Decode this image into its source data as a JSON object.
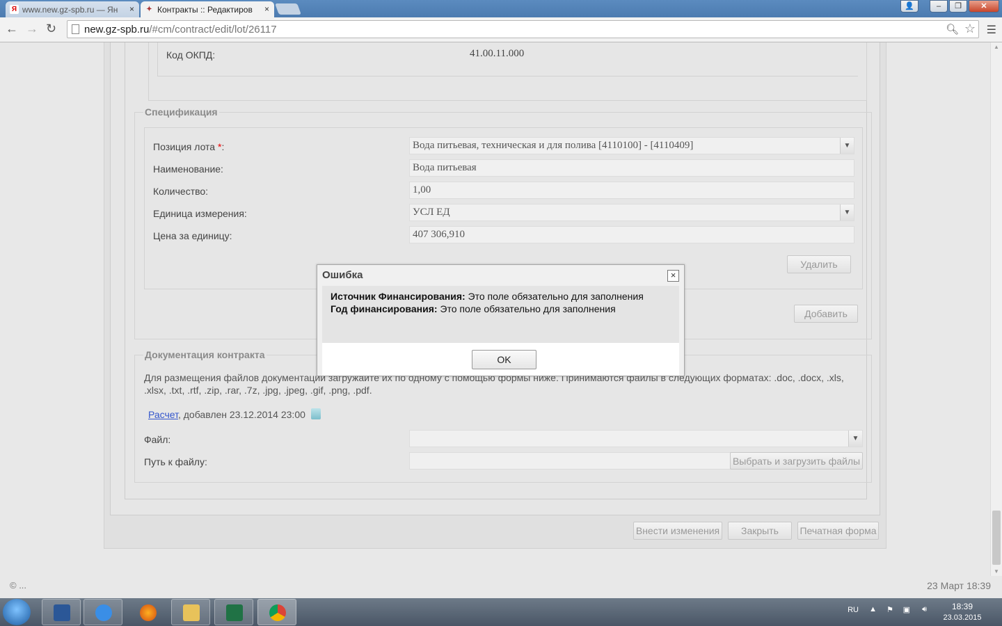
{
  "browser": {
    "tabs": [
      {
        "title": "www.new.gz-spb.ru — Ян",
        "close": "×"
      },
      {
        "title": "Контракты :: Редактиров",
        "close": "×"
      }
    ],
    "url_host": "new.gz-spb.ru",
    "url_path": "/#cm/contract/edit/lot/26117"
  },
  "okpd": {
    "label": "Код ОКПД:",
    "value": "41.00.11.000"
  },
  "spec": {
    "legend": "Спецификация",
    "lot_position": {
      "label": "Позиция лота ",
      "req": "*",
      "colon": ":",
      "value": "Вода питьевая, техническая и для полива [4110100] - [4110409]"
    },
    "name": {
      "label": "Наименование:",
      "value": "Вода питьевая"
    },
    "quantity": {
      "label": "Количество:",
      "value": "1,00"
    },
    "unit": {
      "label": "Единица измерения:",
      "value": "УСЛ ЕД"
    },
    "price": {
      "label": "Цена за единицу:",
      "value": "407 306,910"
    },
    "delete_btn": "Удалить",
    "add_btn": "Добавить"
  },
  "docs": {
    "legend": "Документация контракта",
    "description": "Для размещения файлов документации загружайте их по одному с помощью формы ниже. Принимаются файлы в следующих форматах: .doc, .docx, .xls, .xlsx, .txt, .rtf, .zip, .rar, .7z, .jpg, .jpeg, .gif, .png, .pdf.",
    "file_link": "Расчет",
    "file_added": ", добавлен 23.12.2014 23:00",
    "file_label": "Файл:",
    "path_label": "Путь к файлу:",
    "upload_btn": "Выбрать и загрузить файлы"
  },
  "actions": {
    "save": "Внести изменения",
    "close": "Закрыть",
    "print": "Печатная форма"
  },
  "footer": {
    "copyright": "© ...",
    "datetime": "23 Март 18:39"
  },
  "modal": {
    "title": "Ошибка",
    "close": "×",
    "error1_field": "Источник Финансирования:",
    "error1_text": " Это поле обязательно для заполнения",
    "error2_field": "Год финансирования:",
    "error2_text": " Это поле обязательно для заполнения",
    "ok": "OK"
  },
  "taskbar": {
    "lang": "RU",
    "time": "18:39",
    "date": "23.03.2015"
  }
}
